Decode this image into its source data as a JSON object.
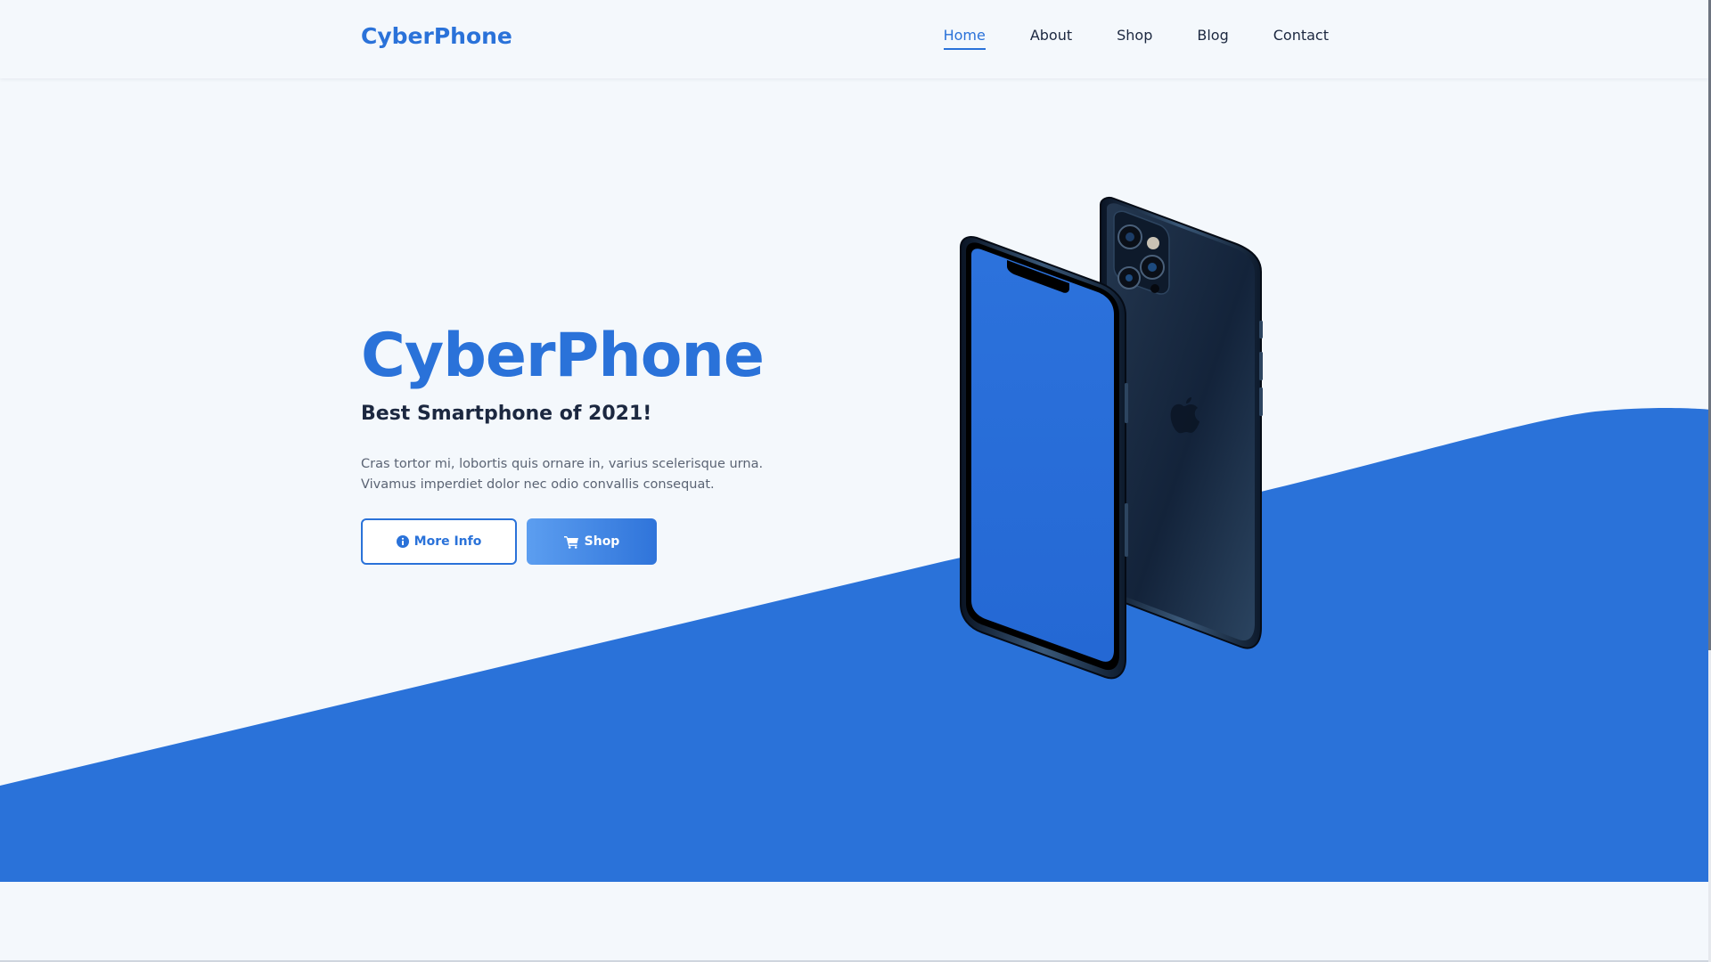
{
  "colors": {
    "accent": "#2a72d9",
    "background": "#f4f8fc",
    "text_dark": "#1c2840",
    "text_muted": "#5b6474"
  },
  "header": {
    "logo": "CyberPhone",
    "nav": [
      {
        "label": "Home",
        "active": true
      },
      {
        "label": "About",
        "active": false
      },
      {
        "label": "Shop",
        "active": false
      },
      {
        "label": "Blog",
        "active": false
      },
      {
        "label": "Contact",
        "active": false
      }
    ]
  },
  "hero": {
    "title": "CyberPhone",
    "subtitle": "Best Smartphone of 2021!",
    "description": "Cras tortor mi, lobortis quis ornare in, varius scelerisque urna. Vivamus imperdiet dolor nec odio convallis consequat.",
    "buttons": {
      "more_info": {
        "label": "More Info",
        "icon": "info-circle-icon"
      },
      "shop": {
        "label": "Shop",
        "icon": "cart-icon"
      }
    }
  },
  "image": {
    "subject": "phone-front-and-back",
    "icon": "apple-logo-icon"
  }
}
